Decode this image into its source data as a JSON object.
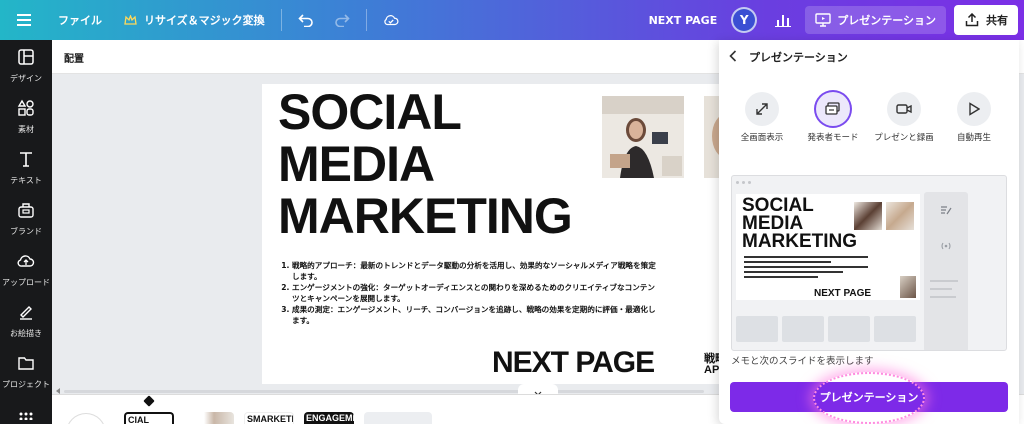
{
  "topbar": {
    "file_label": "ファイル",
    "resize_label": "リサイズ＆マジック変換",
    "doc_title": "NEXT PAGE",
    "avatar_letter": "Y",
    "present_label": "プレゼンテーション",
    "share_label": "共有"
  },
  "sidebar": {
    "items": [
      {
        "label": "デザイン",
        "icon": "layout-icon"
      },
      {
        "label": "素材",
        "icon": "shapes-icon"
      },
      {
        "label": "テキスト",
        "icon": "text-icon"
      },
      {
        "label": "ブランド",
        "icon": "brand-icon"
      },
      {
        "label": "アップロード",
        "icon": "upload-icon"
      },
      {
        "label": "お絵描き",
        "icon": "draw-icon"
      },
      {
        "label": "プロジェクト",
        "icon": "folder-icon"
      }
    ]
  },
  "subbar": {
    "arrange_label": "配置"
  },
  "slide": {
    "title_lines": [
      "SOCIAL",
      "MEDIA",
      "MARKETING"
    ],
    "list": [
      "戦略的アプローチ：最新のトレンドとデータ駆動の分析を活用し、効果的なソーシャルメディア戦略を策定します。",
      "エンゲージメントの強化：ターゲットオーディエンスとの関わりを深めるためのクリエイティブなコンテンツとキャンペーンを展開します。",
      "成果の測定：エンゲージメント、リーチ、コンバージョンを追跡し、戦略の効果を定期的に評価・最適化します。"
    ],
    "next_text": "NEXT PAGE",
    "stub_lines": [
      "戦略",
      "AP"
    ]
  },
  "filmstrip": {
    "thumbs": [
      "CIAL",
      "",
      "SMARKETI",
      "ENGAGEMI",
      ""
    ]
  },
  "panel": {
    "title": "プレゼンテーション",
    "modes": [
      {
        "label": "全画面表示",
        "icon": "fullscreen-icon"
      },
      {
        "label": "発表者モード",
        "icon": "presenter-icon"
      },
      {
        "label": "プレゼンと録画",
        "icon": "camera-icon"
      },
      {
        "label": "自動再生",
        "icon": "play-icon"
      }
    ],
    "preview": {
      "title_lines": [
        "SOCIAL",
        "MEDIA",
        "MARKETING"
      ],
      "next_text": "NEXT PAGE"
    },
    "caption": "メモと次のスライドを表示します",
    "button_label": "プレゼンテーション"
  },
  "colors": {
    "accent": "#7d2ae8",
    "sidebar_bg": "#18191b",
    "highlight_glow": "#ff8adf"
  }
}
